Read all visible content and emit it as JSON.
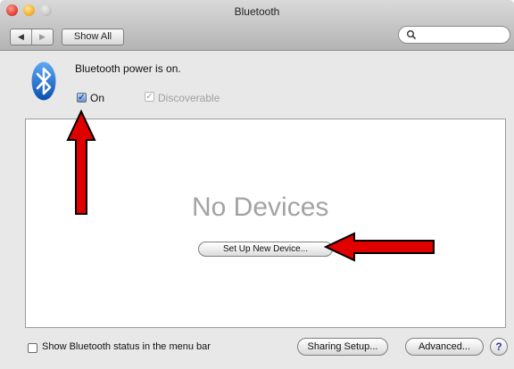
{
  "window": {
    "title": "Bluetooth",
    "nav": {
      "back_icon": "◀",
      "forward_icon": "▶"
    },
    "show_all_label": "Show All",
    "search": {
      "value": "",
      "placeholder": ""
    }
  },
  "status": {
    "power_text": "Bluetooth power is on.",
    "on_label": "On",
    "on_checked": true,
    "discoverable_label": "Discoverable",
    "discoverable_checked": true,
    "discoverable_enabled": false
  },
  "devices": {
    "empty_text": "No Devices",
    "setup_button_label": "Set Up New Device..."
  },
  "footer": {
    "menu_bar_label": "Show Bluetooth status in the menu bar",
    "menu_bar_checked": false,
    "sharing_button_label": "Sharing Setup...",
    "advanced_button_label": "Advanced...",
    "help_label": "?"
  },
  "colors": {
    "annotation_arrow": "#e10000",
    "bluetooth_blue": "#1e73d8"
  }
}
